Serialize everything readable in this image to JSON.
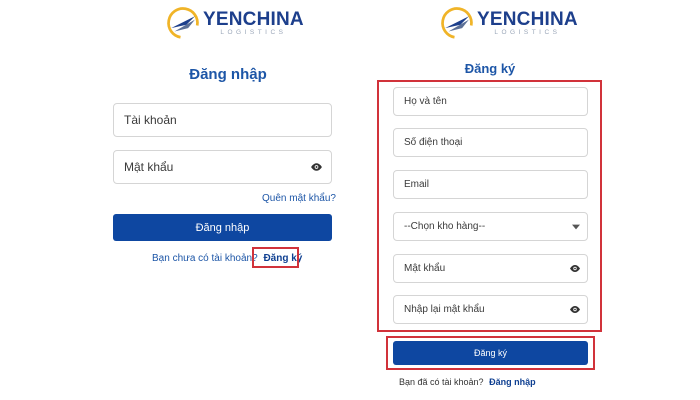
{
  "brand": {
    "name": "YENCHINA",
    "subtitle": "LOGISTICS"
  },
  "login": {
    "title": "Đăng nhập",
    "account_placeholder": "Tài khoản",
    "password_placeholder": "Mật khẩu",
    "forgot_label": "Quên mật khẩu?",
    "submit_label": "Đăng nhập",
    "no_account_text": "Bạn chưa có tài khoản?",
    "register_link": "Đăng ký"
  },
  "register": {
    "title": "Đăng ký",
    "fullname_placeholder": "Họ và tên",
    "phone_placeholder": "Số điện thoại",
    "email_placeholder": "Email",
    "warehouse_select": "--Chọn kho hàng--",
    "password_placeholder": "Mật khẩu",
    "confirm_password_placeholder": "Nhập lại mật khẩu",
    "submit_label": "Đăng ký",
    "have_account_text": "Bạn đã có tài khoản?",
    "login_link": "Đăng nhập"
  },
  "colors": {
    "brand_blue": "#0e47a1",
    "title_blue": "#1d56a7",
    "highlight_red": "#d1323a",
    "logo_gold": "#f0b428"
  }
}
